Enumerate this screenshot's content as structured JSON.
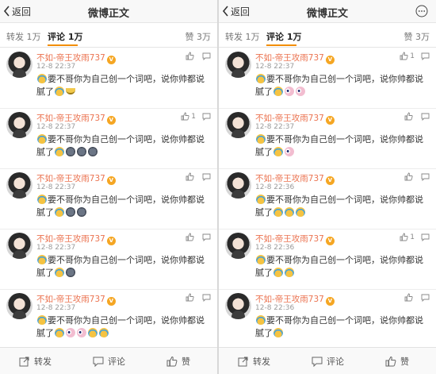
{
  "colors": {
    "username": "#eb7350",
    "accent": "#f28d00",
    "text": "#333333",
    "muted": "#9a9a9a"
  },
  "panels": [
    {
      "header": {
        "back_label": "返回",
        "title": "微博正文",
        "more_icon": "more-dots-icon"
      },
      "tabs": {
        "repost": "转发 1万",
        "comments": "评论 1万",
        "likes": "赞 3万"
      },
      "comments": [
        {
          "username": "不如-帝王攻雨737",
          "time": "12-8 22:37",
          "text": "要不哥你为自己创一个词吧，说你帅都说腻了",
          "emojis": [
            "sweat-face",
            "banana"
          ],
          "likes": ""
        },
        {
          "username": "不如-帝王攻雨737",
          "time": "12-8 22:37",
          "text": "要不哥你为自己创一个词吧，说你帅都说腻了",
          "emojis": [
            "sweat-face",
            "dark-moon",
            "dark-moon",
            "dark-moon"
          ],
          "likes": "1"
        },
        {
          "username": "不如-帝王攻雨737",
          "time": "12-8 22:37",
          "text": "要不哥你为自己创一个词吧，说你帅都说腻了",
          "emojis": [
            "sweat-face",
            "dark-moon",
            "dark-moon"
          ],
          "likes": ""
        },
        {
          "username": "不如-帝王攻雨737",
          "time": "12-8 22:37",
          "text": "要不哥你为自己创一个词吧，说你帅都说腻了",
          "emojis": [
            "sweat-face",
            "dark-moon"
          ],
          "likes": ""
        },
        {
          "username": "不如-帝王攻雨737",
          "time": "12-8 22:37",
          "text": "要不哥你为自己创一个词吧，说你帅都说腻了",
          "emojis": [
            "sweat-face",
            "pink-eyes",
            "pink-eyes",
            "sweat-face",
            "sweat-face"
          ],
          "likes": ""
        }
      ],
      "footer": {
        "repost_label": "转发",
        "comment_label": "评论",
        "like_label": "赞"
      }
    },
    {
      "header": {
        "back_label": "返回",
        "title": "微博正文",
        "more_icon": "more-dots-icon"
      },
      "tabs": {
        "repost": "转发 1万",
        "comments": "评论 1万",
        "likes": "赞 3万"
      },
      "comments": [
        {
          "username": "不如-帝王攻雨737",
          "time": "12-8 22:37",
          "text": "要不哥你为自己创一个词吧，说你帅都说腻了",
          "emojis": [
            "sweat-face",
            "pink-eyes",
            "pink-eyes"
          ],
          "likes": "1"
        },
        {
          "username": "不如-帝王攻雨737",
          "time": "12-8 22:37",
          "text": "要不哥你为自己创一个词吧，说你帅都说腻了",
          "emojis": [
            "sweat-face",
            "pink-eyes"
          ],
          "likes": ""
        },
        {
          "username": "不如-帝王攻雨737",
          "time": "12-8 22:36",
          "text": "要不哥你为自己创一个词吧，说你帅都说腻了",
          "emojis": [
            "sweat-face",
            "sweat-face",
            "sweat-face"
          ],
          "likes": ""
        },
        {
          "username": "不如-帝王攻雨737",
          "time": "12-8 22:36",
          "text": "要不哥你为自己创一个词吧，说你帅都说腻了",
          "emojis": [
            "sweat-face",
            "sweat-face"
          ],
          "likes": "1"
        },
        {
          "username": "不如-帝王攻雨737",
          "time": "12-8 22:36",
          "text": "要不哥你为自己创一个词吧，说你帅都说腻了",
          "emojis": [
            "sweat-face"
          ],
          "likes": ""
        }
      ],
      "footer": {
        "repost_label": "转发",
        "comment_label": "评论",
        "like_label": "赞"
      }
    }
  ]
}
